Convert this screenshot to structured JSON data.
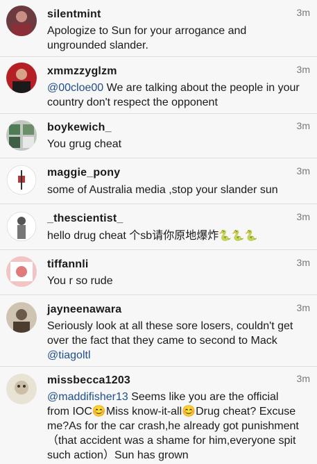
{
  "comments": [
    {
      "user": "silentmint",
      "time": "3m",
      "text": "Apologize to Sun for your arrogance and ungrounded slander."
    },
    {
      "user": "xmmzzyglzm",
      "time": "3m",
      "mention": "@00cloe00",
      "text": " We are talking about the people in your country don't respect the opponent"
    },
    {
      "user": "boykewich_",
      "time": "3m",
      "text": "You grug cheat"
    },
    {
      "user": "maggie_pony",
      "time": "3m",
      "text": "some of Australia media ,stop your slander sun"
    },
    {
      "user": "_thescientist_",
      "time": "3m",
      "text": "hello drug cheat 个sb请你原地爆炸",
      "emoji": "🐍🐍🐍"
    },
    {
      "user": "tiffannli",
      "time": "3m",
      "text": "You r so rude"
    },
    {
      "user": "jayneenawara",
      "time": "3m",
      "text": "Seriously look at all these sore losers, couldn't get over the fact that they came to second to Mack ",
      "mention": "@tiagoltl"
    },
    {
      "user": "missbecca1203",
      "time": "3m",
      "mention": "@maddifisher13",
      "text": " Seems like you are the official from IOC😊Miss know-it-all😊Drug cheat? Excuse me?As for the car crash,he already got punishment（that accident was a shame for him,everyone spit such action）Sun has grown"
    }
  ]
}
